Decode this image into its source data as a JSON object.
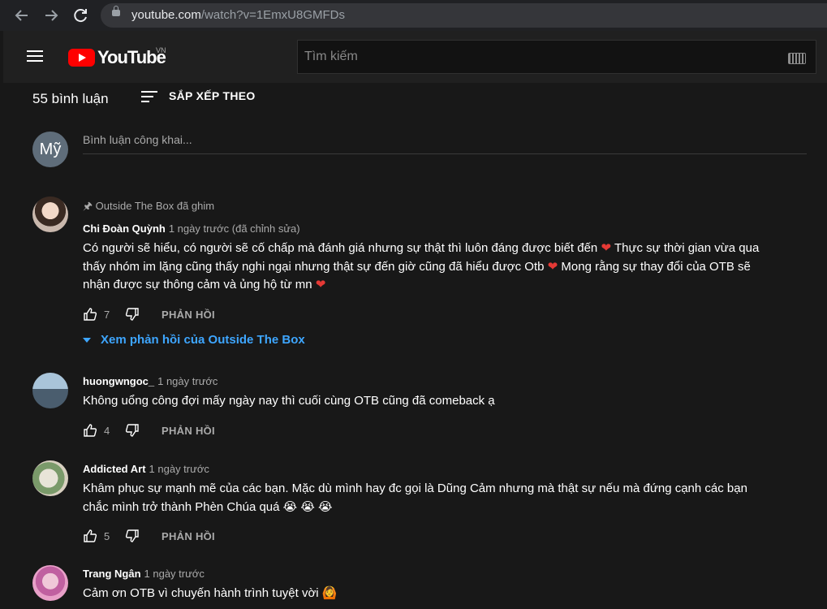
{
  "browser": {
    "url_host": "youtube.com",
    "url_path": "/watch?v=1EmxU8GMFDs"
  },
  "youtube": {
    "logo_text": "YouTube",
    "region": "VN",
    "search_placeholder": "Tìm kiếm"
  },
  "comments_header": {
    "count_label": "55 bình luận",
    "sort_label": "SẮP XẾP THEO"
  },
  "compose": {
    "avatar_initials": "Mỹ",
    "placeholder": "Bình luận công khai..."
  },
  "comments": [
    {
      "pinned_label": "Outside The Box đã ghim",
      "author": "Chi Đoàn Quỳnh",
      "time": "1 ngày trước (đã chỉnh sửa)",
      "text_parts": [
        "Có người sẽ hiểu, có người sẽ cố chấp mà đánh giá nhưng sự thật thì luôn đáng được biết đến",
        "Thực sự thời gian vừa qua thấy nhóm im lặng cũng thấy nghi ngại nhưng thật sự đến giờ cũng đã hiểu được Otb",
        "Mong rằng sự thay đổi của OTB sẽ nhận được sự thông cảm và ủng hộ từ mn"
      ],
      "emoji": "❤",
      "likes": "7",
      "reply_label": "PHẢN HỒI",
      "view_replies": "Xem phản hồi của Outside The Box"
    },
    {
      "author": "huongwngoc_",
      "time": "1 ngày trước",
      "text": "Không uổng công đợi mấy ngày nay thì cuối cùng OTB cũng đã comeback ạ",
      "likes": "4",
      "reply_label": "PHẢN HỒI"
    },
    {
      "author": "Addicted Art",
      "time": "1 ngày trước",
      "text": "Khâm phục sự mạnh mẽ của các bạn. Mặc dù mình hay đc gọi là Dũng Cảm nhưng mà thật sự nếu mà đứng cạnh các bạn chắc mình trở thành Phèn Chúa quá 😭 😭 😭",
      "likes": "5",
      "reply_label": "PHẢN HỒI"
    },
    {
      "author": "Trang Ngân",
      "time": "1 ngày trước",
      "text": "Cảm ơn OTB vì chuyến hành trình tuyệt vời 🙆"
    }
  ],
  "colors": {
    "accent_blue": "#3ea6ff",
    "youtube_red": "#ff0000",
    "background": "#181818"
  }
}
